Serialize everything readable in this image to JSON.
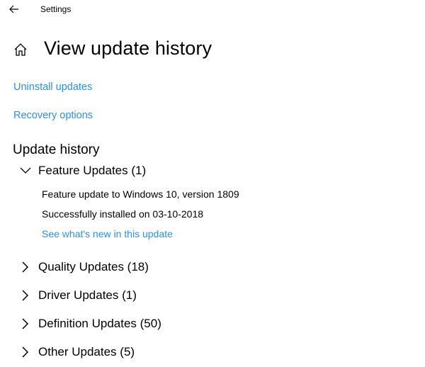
{
  "titlebar": {
    "back_icon": "arrow-left-icon",
    "title": "Settings"
  },
  "header": {
    "home_icon": "home-icon",
    "title": "View update history"
  },
  "links": {
    "uninstall": "Uninstall updates",
    "recovery": "Recovery options"
  },
  "history": {
    "title": "Update history",
    "groups": [
      {
        "label": "Feature Updates (1)",
        "expanded": true,
        "icon": "chevron-down-icon",
        "items": [
          {
            "name": "Feature update to Windows 10, version 1809",
            "status": "Successfully installed on 03-10-2018",
            "link": "See what's new in this update"
          }
        ]
      },
      {
        "label": "Quality Updates (18)",
        "expanded": false,
        "icon": "chevron-right-icon"
      },
      {
        "label": "Driver Updates (1)",
        "expanded": false,
        "icon": "chevron-right-icon"
      },
      {
        "label": "Definition Updates (50)",
        "expanded": false,
        "icon": "chevron-right-icon"
      },
      {
        "label": "Other Updates (5)",
        "expanded": false,
        "icon": "chevron-right-icon"
      }
    ]
  },
  "colors": {
    "link": "#2d8fe6",
    "text": "#000000",
    "background": "#ffffff"
  }
}
